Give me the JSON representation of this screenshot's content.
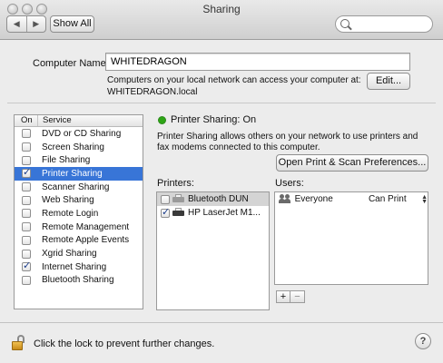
{
  "window": {
    "title": "Sharing"
  },
  "toolbar": {
    "back_icon": "◀",
    "forward_icon": "▶",
    "show_all_label": "Show All",
    "search_placeholder": ""
  },
  "computer_name": {
    "label": "Computer Name:",
    "value": "WHITEDRAGON",
    "description_line1": "Computers on your local network can access your computer at:",
    "description_line2": "WHITEDRAGON.local",
    "edit_label": "Edit..."
  },
  "services": {
    "header_on": "On",
    "header_service": "Service",
    "items": [
      {
        "label": "DVD or CD Sharing",
        "checked": false,
        "selected": false
      },
      {
        "label": "Screen Sharing",
        "checked": false,
        "selected": false
      },
      {
        "label": "File Sharing",
        "checked": false,
        "selected": false
      },
      {
        "label": "Printer Sharing",
        "checked": true,
        "selected": true
      },
      {
        "label": "Scanner Sharing",
        "checked": false,
        "selected": false
      },
      {
        "label": "Web Sharing",
        "checked": false,
        "selected": false
      },
      {
        "label": "Remote Login",
        "checked": false,
        "selected": false
      },
      {
        "label": "Remote Management",
        "checked": false,
        "selected": false
      },
      {
        "label": "Remote Apple Events",
        "checked": false,
        "selected": false
      },
      {
        "label": "Xgrid Sharing",
        "checked": false,
        "selected": false
      },
      {
        "label": "Internet Sharing",
        "checked": true,
        "selected": false
      },
      {
        "label": "Bluetooth Sharing",
        "checked": false,
        "selected": false
      }
    ]
  },
  "detail": {
    "status_text": "Printer Sharing: On",
    "status_color": "#2ea516",
    "description": "Printer Sharing allows others on your network to use printers and fax modems connected to this computer.",
    "prefs_button_label": "Open Print & Scan Preferences...",
    "printers_label": "Printers:",
    "users_label": "Users:",
    "printers": [
      {
        "name": "Bluetooth DUN",
        "checked": false,
        "icon": "printer-icon-gray"
      },
      {
        "name": "HP LaserJet M1...",
        "checked": true,
        "icon": "printer-icon-dark"
      }
    ],
    "users": [
      {
        "name": "Everyone",
        "permission": "Can Print",
        "icon": "users-group-icon"
      }
    ],
    "add_label": "+",
    "remove_label": "−"
  },
  "footer": {
    "lock_text": "Click the lock to prevent further changes.",
    "help_label": "?"
  }
}
